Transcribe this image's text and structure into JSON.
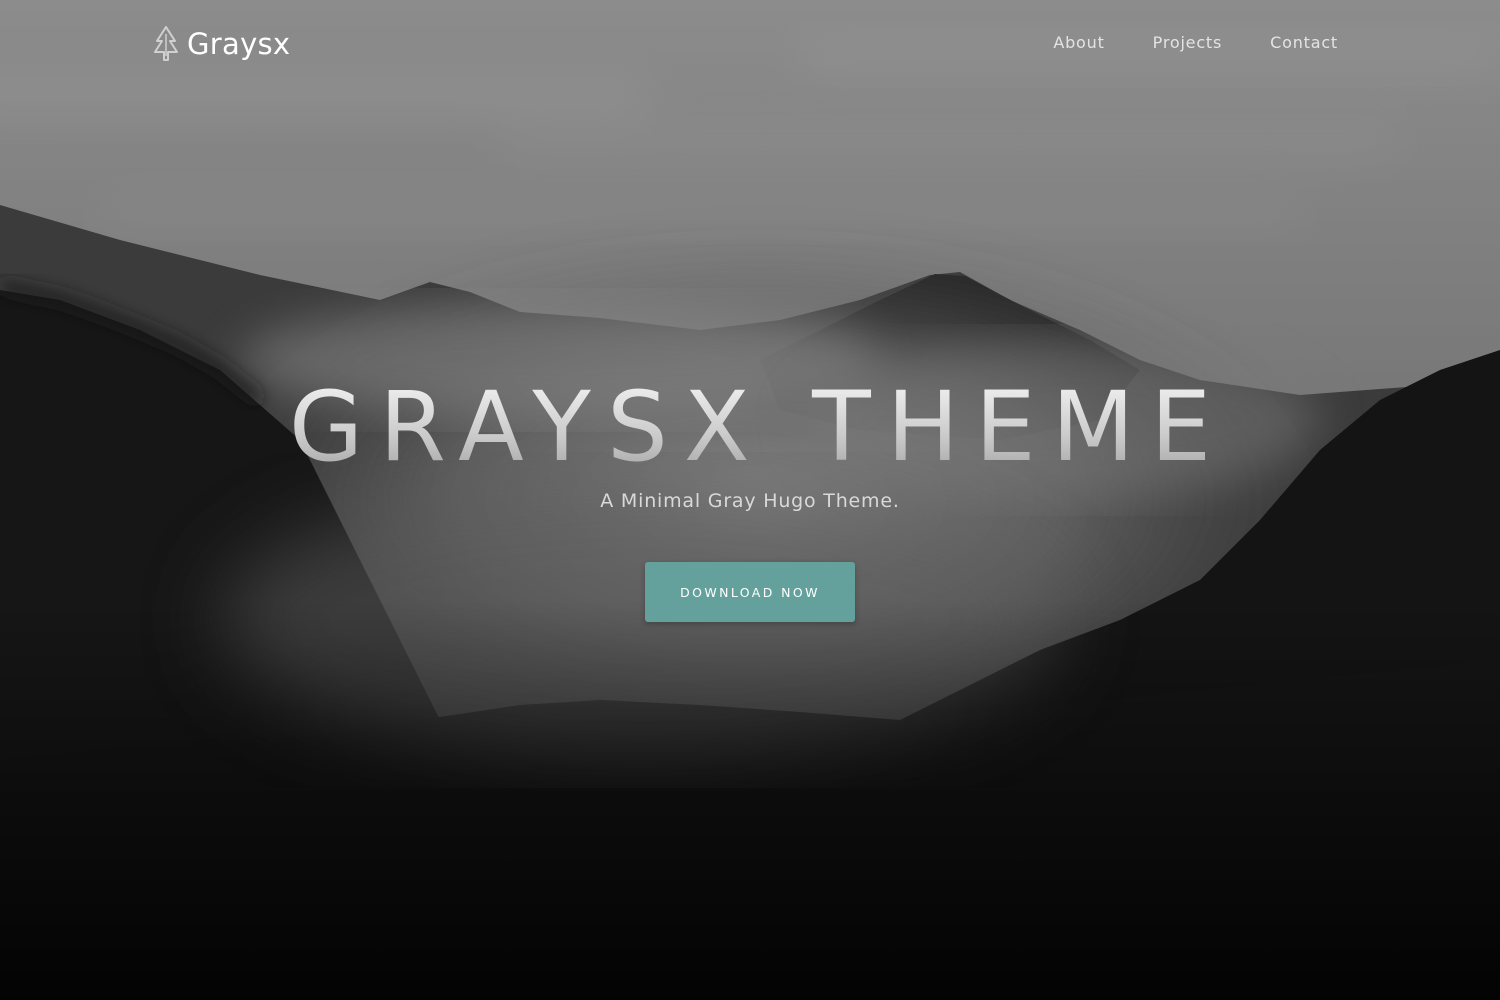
{
  "navbar": {
    "brand": {
      "icon": "tree-icon",
      "name": "Graysx"
    },
    "links": [
      {
        "label": "About"
      },
      {
        "label": "Projects"
      },
      {
        "label": "Contact"
      }
    ]
  },
  "hero": {
    "title": "GRAYSX THEME",
    "subtitle": "A Minimal Gray Hugo Theme.",
    "cta_label": "DOWNLOAD NOW",
    "background": "misty-mountain-forest-photo"
  },
  "colors": {
    "accent": "#64a19d",
    "text_light": "#ffffff"
  }
}
